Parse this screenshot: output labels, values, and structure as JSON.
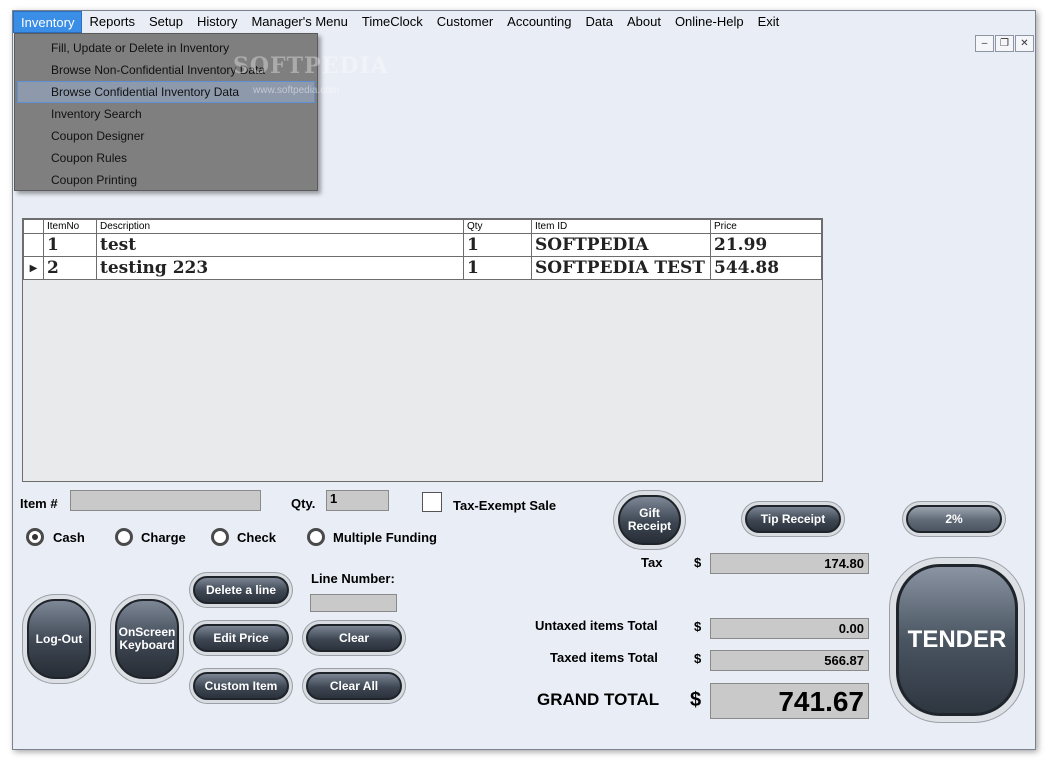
{
  "menu": {
    "items": [
      "Inventory",
      "Reports",
      "Setup",
      "History",
      "Manager's Menu",
      "TimeClock",
      "Customer",
      "Accounting",
      "Data",
      "About",
      "Online-Help",
      "Exit"
    ],
    "active_index": 0
  },
  "window_controls": {
    "minimize": "–",
    "restore": "❐",
    "close": "✕"
  },
  "dropdown": {
    "items": [
      "Fill, Update or Delete in  Inventory",
      "Browse Non-Confidential Inventory Data",
      "Browse Confidential Inventory Data",
      "Inventory Search",
      "Coupon Designer",
      "Coupon Rules",
      "Coupon Printing"
    ],
    "highlighted_index": 2
  },
  "watermark": {
    "text": "SOFTPEDIA",
    "url": "www.softpedia.com"
  },
  "grid": {
    "columns": [
      "ItemNo",
      "Description",
      "Qty",
      "Item ID",
      "Price"
    ],
    "rows": [
      {
        "itemno": "1",
        "description": "test",
        "qty": "1",
        "itemid": "SOFTPEDIA",
        "price": "21.99",
        "current": false
      },
      {
        "itemno": "2",
        "description": "testing 223",
        "qty": "1",
        "itemid": "SOFTPEDIA TEST",
        "price": "544.88",
        "current": true
      }
    ]
  },
  "entry": {
    "item_label": "Item #",
    "item_value": "",
    "qty_label": "Qty.",
    "qty_value": "1",
    "tax_exempt_label": "Tax-Exempt Sale"
  },
  "payment": {
    "options": [
      "Cash",
      "Charge",
      "Check",
      "Multiple Funding"
    ],
    "selected": "Cash"
  },
  "buttons": {
    "gift_receipt": "Gift Receipt",
    "tip_receipt": "Tip Receipt",
    "two_percent": "2%",
    "logout": "Log-Out",
    "onscreen_keyboard": "OnScreen Keyboard",
    "delete_line": "Delete a line",
    "edit_price": "Edit Price",
    "clear": "Clear",
    "custom_item": "Custom Item",
    "clear_all": "Clear All",
    "tender": "TENDER"
  },
  "line_number": {
    "label": "Line Number:",
    "value": ""
  },
  "totals": {
    "currency": "$",
    "tax_label": "Tax",
    "tax_value": "174.80",
    "untaxed_label": "Untaxed items Total",
    "untaxed_value": "0.00",
    "taxed_label": "Taxed items Total",
    "taxed_value": "566.87",
    "grand_label": "GRAND TOTAL",
    "grand_value": "741.67"
  }
}
